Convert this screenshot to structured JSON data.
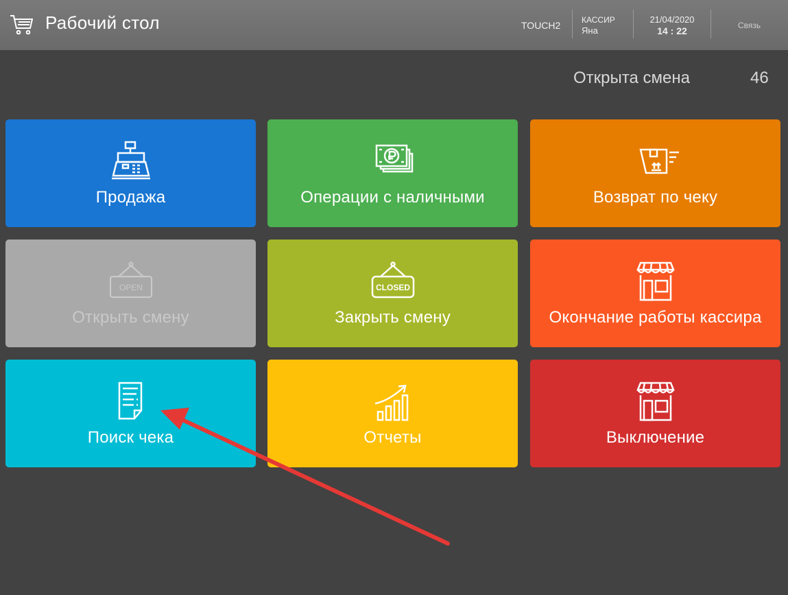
{
  "header": {
    "title": "Рабочий стол",
    "terminal": "TOUCH2",
    "cashier_role": "КАССИР",
    "cashier_name": "Яна",
    "date": "21/04/2020",
    "time": "14 : 22",
    "link": "Связь"
  },
  "shift": {
    "status": "Открыта смена",
    "number": "46"
  },
  "tiles": [
    {
      "label": "Продажа",
      "color": "#1976d2",
      "icon": "cash-register-icon"
    },
    {
      "label": "Операции с наличными",
      "color": "#4caf50",
      "icon": "banknotes-icon"
    },
    {
      "label": "Возврат по чеку",
      "color": "#e67c00",
      "icon": "return-box-icon"
    },
    {
      "label": "Открыть смену",
      "color": "#a9a9a9",
      "icon": "open-sign-icon",
      "sign_text": "OPEN"
    },
    {
      "label": "Закрыть смену",
      "color": "#a4b72a",
      "icon": "closed-sign-icon",
      "sign_text": "CLOSED"
    },
    {
      "label": "Окончание работы кассира",
      "color": "#fb5722",
      "icon": "store-icon"
    },
    {
      "label": "Поиск чека",
      "color": "#00bcd4",
      "icon": "receipt-icon"
    },
    {
      "label": "Отчеты",
      "color": "#ffc107",
      "icon": "growth-chart-icon"
    },
    {
      "label": "Выключение",
      "color": "#d32f2f",
      "icon": "store-icon"
    }
  ],
  "colors": {
    "background": "#424242",
    "header": "#727272",
    "annotation_arrow": "#e53935"
  }
}
